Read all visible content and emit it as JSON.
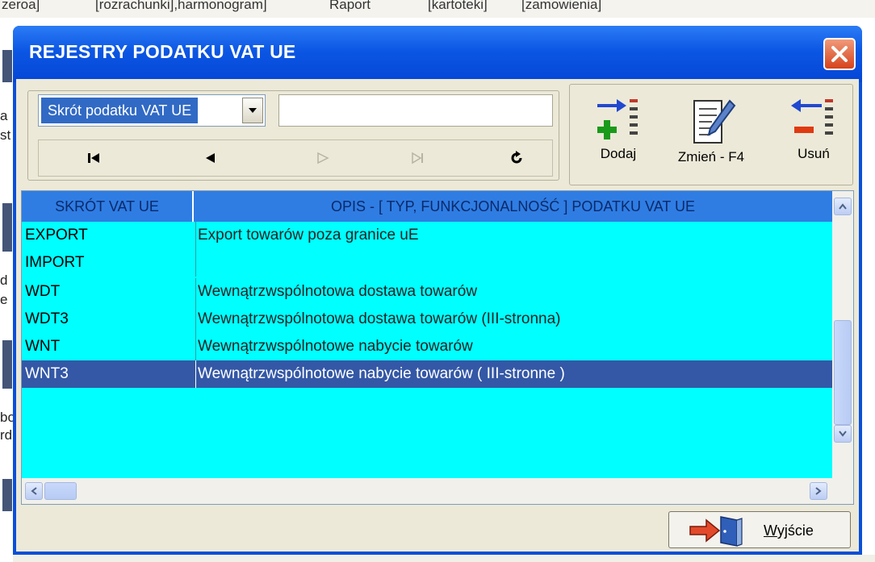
{
  "background": {
    "menu_items": [
      "zeroa]",
      "[rozrachunki],harmonogram]",
      "Raport",
      "[kartoteki]",
      "[zamowienia]"
    ],
    "left_letters": [
      "a",
      "st",
      "d",
      "e",
      "bo",
      "rd"
    ]
  },
  "dialog": {
    "title": "REJESTRY PODATKU VAT UE",
    "close_icon": "close-icon",
    "colors": {
      "title_bar": "#0b56e3",
      "close": "#d6431c",
      "grid_bg": "#00ffff",
      "header_bg": "#2f7de3",
      "selection": "#3458a6"
    }
  },
  "search": {
    "field_selected": "Skrót podatku VAT UE",
    "value": "",
    "placeholder": ""
  },
  "navigation": {
    "first_icon": "first-record-icon",
    "prev_icon": "prev-record-icon",
    "next_icon": "next-record-icon",
    "last_icon": "last-record-icon",
    "refresh_icon": "refresh-icon"
  },
  "actions": {
    "add_label": "Dodaj",
    "edit_label": "Zmień - F4",
    "delete_label": "Usuń"
  },
  "grid": {
    "columns": [
      "SKRÓT VAT UE",
      "OPIS - [ TYP, FUNKCJONALNOŚĆ ] PODATKU VAT UE"
    ],
    "rows": [
      {
        "code": "EXPORT",
        "description": "Export towarów poza granice uE"
      },
      {
        "code": "IMPORT",
        "description": ""
      },
      {
        "code": "WDT",
        "description": "Wewnątrzwspólnotowa dostawa towarów"
      },
      {
        "code": "WDT3",
        "description": "Wewnątrzwspólnotowa dostawa towarów (III-stronna)"
      },
      {
        "code": "WNT",
        "description": "Wewnątrzwspólnotowe nabycie towarów"
      },
      {
        "code": "WNT3",
        "description": "Wewnątrzwspólnotowe nabycie towarów ( III-stronne )"
      }
    ],
    "selected_index": 5
  },
  "footer": {
    "exit_label_underlined": "W",
    "exit_label_rest": "yjście"
  }
}
